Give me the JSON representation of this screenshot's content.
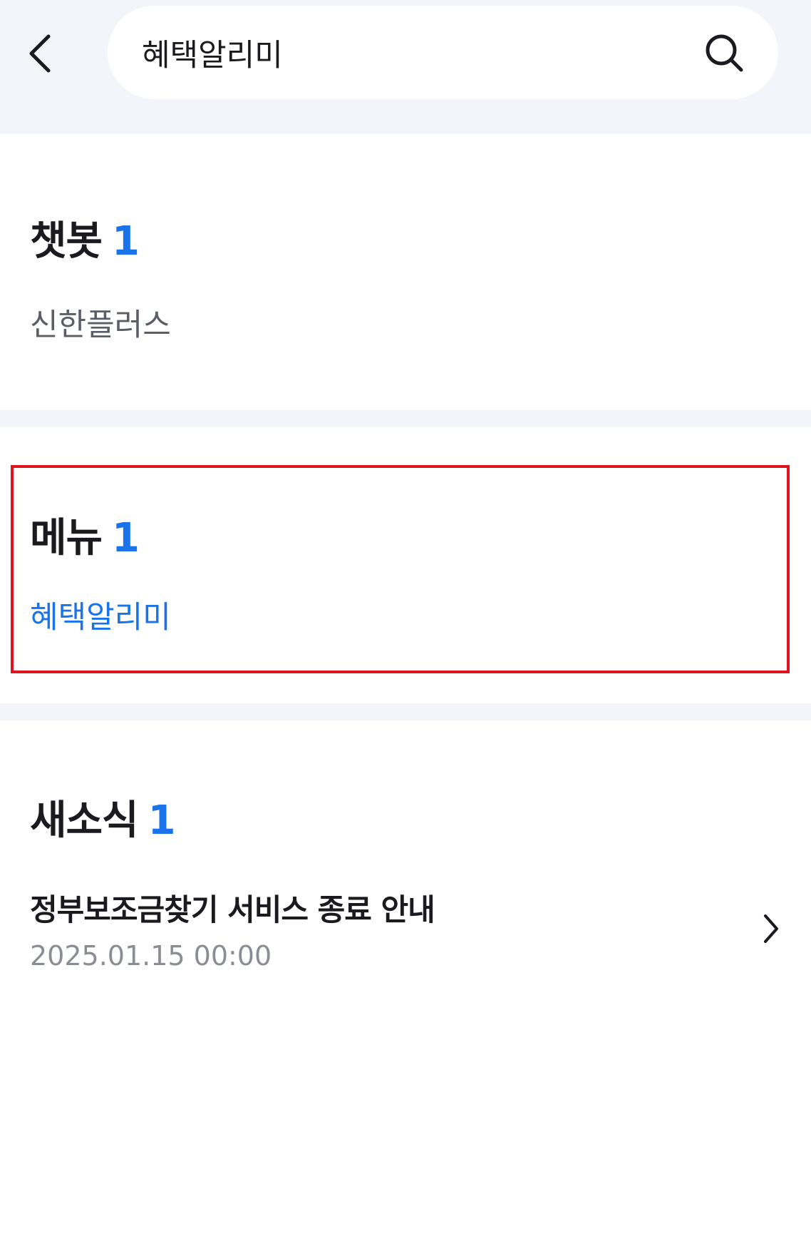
{
  "search": {
    "query": "혜택알리미",
    "back_icon": "chevron-left-icon",
    "search_icon": "search-icon"
  },
  "sections": {
    "chatbot": {
      "title": "챗봇",
      "count": "1",
      "items": [
        "신한플러스"
      ]
    },
    "menu": {
      "title": "메뉴",
      "count": "1",
      "items": [
        "혜택알리미"
      ]
    },
    "news": {
      "title": "새소식",
      "count": "1",
      "items": [
        {
          "title": "정부보조금찾기 서비스 종료 안내",
          "date": "2025.01.15 00:00"
        }
      ]
    }
  },
  "colors": {
    "accent": "#1a73e8",
    "header_bg": "#f3f5fa",
    "highlight_border": "#e0141e",
    "secondary_text": "#8a8d94"
  }
}
